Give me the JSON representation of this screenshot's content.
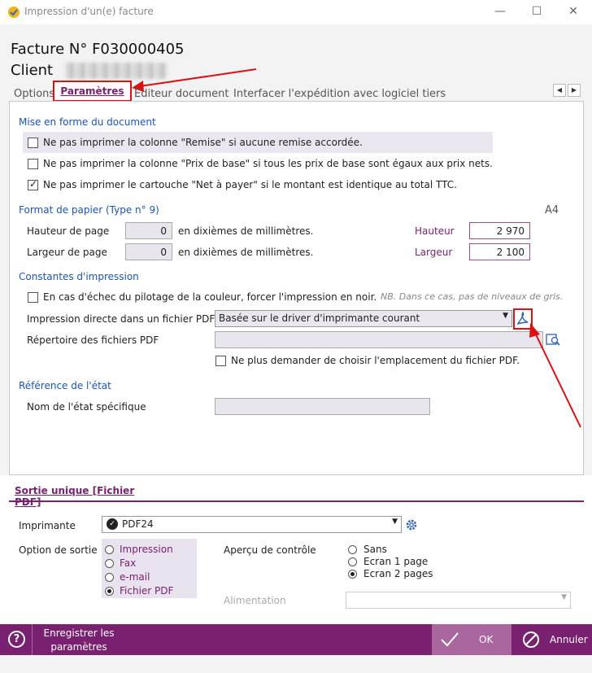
{
  "window": {
    "title": "Impression d'un(e) facture",
    "minimize": "—",
    "maximize": "☐",
    "close": "✕"
  },
  "header": {
    "facture_label": "Facture N° F030000405",
    "client_label": "Client"
  },
  "tabs": [
    "Options",
    "Paramètres",
    "Editeur document",
    "Interfacer l'expédition avec logiciel tiers"
  ],
  "tab_scroll": {
    "left": "◀",
    "right": "▶"
  },
  "mise_en_forme": {
    "title": "Mise en forme du document",
    "options": [
      {
        "label": "Ne pas imprimer la colonne \"Remise\" si aucune remise accordée.",
        "checked": false
      },
      {
        "label": "Ne pas imprimer la colonne \"Prix de base\" si tous les prix de base sont égaux aux prix nets.",
        "checked": false
      },
      {
        "label": "Ne pas imprimer le cartouche \"Net à payer\" si le montant est identique au total TTC.",
        "checked": true
      }
    ]
  },
  "format_papier": {
    "title": "Format de papier (Type n° 9)",
    "format": "A4",
    "hauteur_label": "Hauteur de page",
    "hauteur_value": "0",
    "largeur_label": "Largeur de page",
    "largeur_value": "0",
    "unit": "en dixièmes de millimètres.",
    "hauteur_right_label": "Hauteur",
    "hauteur_right_value": "2 970",
    "largeur_right_label": "Largeur",
    "largeur_right_value": "2 100"
  },
  "constantes": {
    "title": "Constantes d'impression",
    "noir_label": "En cas d'échec du pilotage de la couleur, forcer l'impression en noir.",
    "noir_checked": false,
    "note": "NB. Dans ce cas, pas de niveaux de gris.",
    "pdf_label": "Impression directe dans un fichier PDF",
    "pdf_value": "Basée sur le driver d'imprimante courant",
    "repertoire_label": "Répertoire des fichiers PDF",
    "repertoire_value": "",
    "ne_plus_label": "Ne plus demander de choisir l'emplacement du fichier PDF.",
    "ne_plus_checked": false
  },
  "reference": {
    "title": "Référence de l'état",
    "nom_label": "Nom de l'état spécifique",
    "nom_value": ""
  },
  "sortie": {
    "tab_label": "Sortie unique [Fichier PDF]",
    "imprimante_label": "Imprimante",
    "imprimante_value": "PDF24",
    "option_label": "Option de sortie",
    "options": [
      "Impression",
      "Fax",
      "e-mail",
      "Fichier PDF"
    ],
    "option_selected": 3,
    "apercu_label": "Aperçu de contrôle",
    "apercu_options": [
      "Sans",
      "Ecran 1 page",
      "Ecran 2 pages"
    ],
    "apercu_selected": 2,
    "alimentation_label": "Alimentation",
    "alimentation_value": ""
  },
  "footer": {
    "help": "?",
    "save_line1": "Enregistrer les",
    "save_line2": "paramètres",
    "ok": "OK",
    "cancel": "Annuler"
  },
  "colors": {
    "accent": "#7a2070",
    "section_blue": "#1a55b5",
    "annotation_red": "#dd1111"
  }
}
